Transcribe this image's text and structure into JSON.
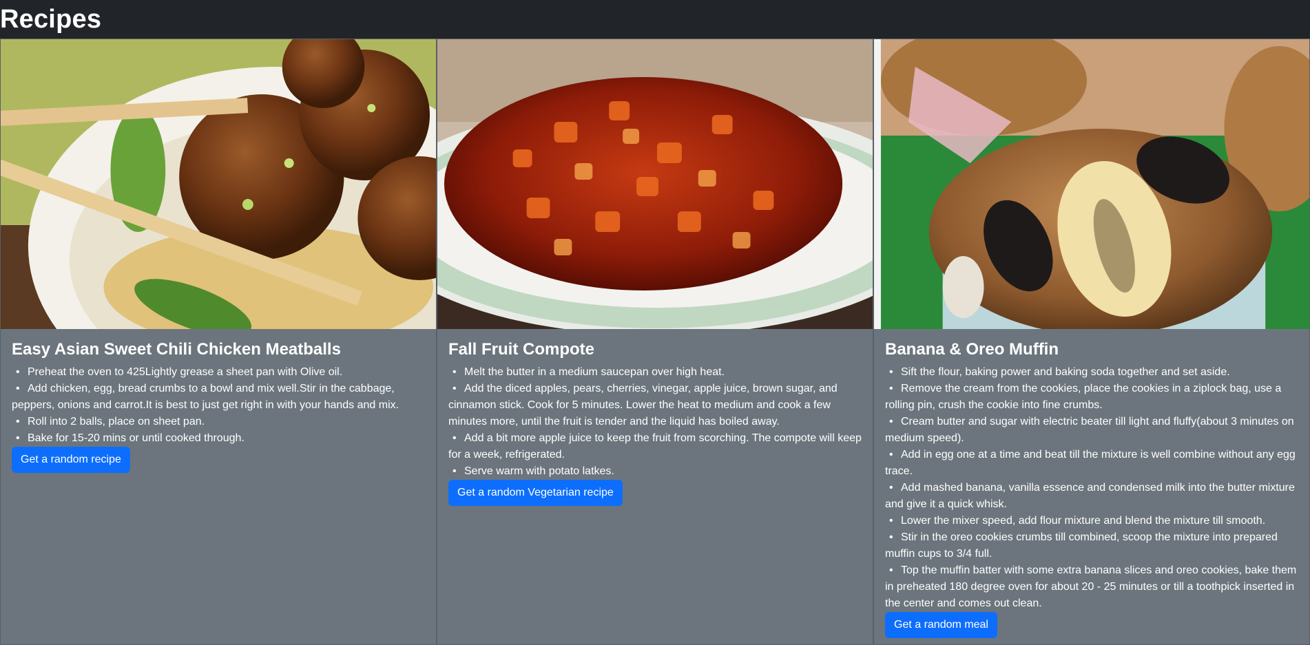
{
  "header": {
    "title": "Recipes"
  },
  "cards": [
    {
      "title": "Easy Asian Sweet Chili Chicken Meatballs",
      "image_alt": "Meatballs with noodles and chopsticks",
      "steps": [
        "Preheat the oven to 425Lightly grease a sheet pan with Olive oil.",
        "Add chicken, egg, bread crumbs to a bowl and mix well.Stir in the cabbage, peppers, onions and carrot.It is best to just get right in with your hands and mix.",
        "Roll into 2 balls, place on sheet pan.",
        "Bake for 15-20 mins or until cooked through."
      ],
      "button_label": "Get a random recipe"
    },
    {
      "title": "Fall Fruit Compote",
      "image_alt": "Fruit compote on a plate",
      "steps": [
        "Melt the butter in a medium saucepan over high heat.",
        "Add the diced apples, pears, cherries, vinegar, apple juice, brown sugar, and cinnamon stick. Cook for 5 minutes. Lower the heat to medium and cook a few minutes more, until the fruit is tender and the liquid has boiled away.",
        "Add a bit more apple juice to keep the fruit from scorching. The compote will keep for a week, refrigerated.",
        "Serve warm with potato latkes."
      ],
      "button_label": "Get a random Vegetarian recipe"
    },
    {
      "title": "Banana & Oreo Muffin",
      "image_alt": "Banana and oreo muffin",
      "steps": [
        "Sift the flour, baking power and baking soda together and set aside.",
        "Remove the cream from the cookies, place the cookies in a ziplock bag, use a rolling pin, crush the cookie into fine crumbs.",
        "Cream butter and sugar with electric beater till light and fluffy(about 3 minutes on medium speed).",
        "Add in egg one at a time and beat till the mixture is well combine without any egg trace.",
        "Add mashed banana, vanilla essence and condensed milk into the butter mixture and give it a quick whisk.",
        "Lower the mixer speed, add flour mixture and blend the mixture till smooth.",
        "Stir in the oreo cookies crumbs till combined, scoop the mixture into prepared muffin cups to 3/4 full.",
        "Top the muffin batter with some extra banana slices and oreo cookies, bake them in preheated 180 degree oven for about 20 - 25 minutes or till a toothpick inserted in the center and comes out clean."
      ],
      "button_label": "Get a random meal"
    }
  ],
  "colors": {
    "header_bg": "#212529",
    "card_bg": "#6c757d",
    "button_bg": "#0d6efd",
    "text": "#ffffff"
  }
}
